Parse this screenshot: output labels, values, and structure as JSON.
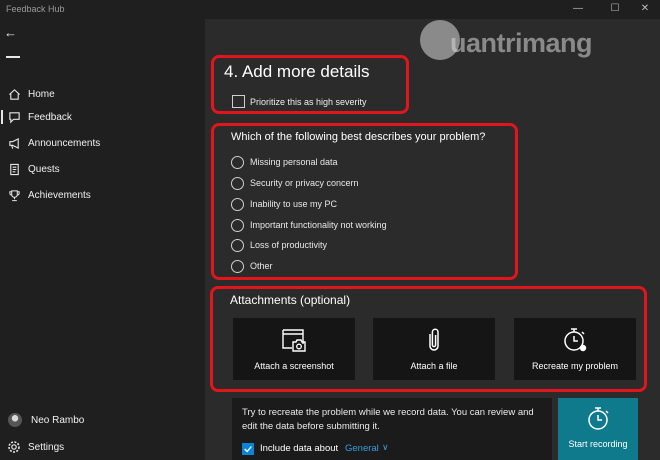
{
  "window": {
    "title": "Feedback Hub",
    "minimize": "—",
    "maximize": "☐",
    "close": "✕"
  },
  "sidebar": {
    "back": "←",
    "items": [
      {
        "label": "Home",
        "icon": "home-icon"
      },
      {
        "label": "Feedback",
        "icon": "feedback-icon",
        "selected": true
      },
      {
        "label": "Announcements",
        "icon": "megaphone-icon"
      },
      {
        "label": "Quests",
        "icon": "quests-icon"
      },
      {
        "label": "Achievements",
        "icon": "trophy-icon"
      }
    ],
    "profile_name": "Neo Rambo",
    "settings_label": "Settings"
  },
  "watermark": {
    "text": "uantrimang"
  },
  "details": {
    "title": "4. Add more details",
    "severity_label": "Prioritize this as high severity"
  },
  "problem": {
    "question": "Which of the following best describes your problem?",
    "options": [
      "Missing personal data",
      "Security or privacy concern",
      "Inability to use my PC",
      "Important functionality not working",
      "Loss of productivity",
      "Other"
    ]
  },
  "attachments": {
    "title": "Attachments (optional)",
    "screenshot_label": "Attach a screenshot",
    "file_label": "Attach a file",
    "recreate_label": "Recreate my problem"
  },
  "recording": {
    "info": "Try to recreate the problem while we record data. You can review and edit the data before submitting it.",
    "include_label": "Include data about",
    "include_value": "General",
    "include_checked": true,
    "start_label": "Start recording"
  },
  "colors": {
    "accent": "#0a84d6",
    "highlight_border": "#e0161c",
    "start_button": "#0e7a8c"
  }
}
